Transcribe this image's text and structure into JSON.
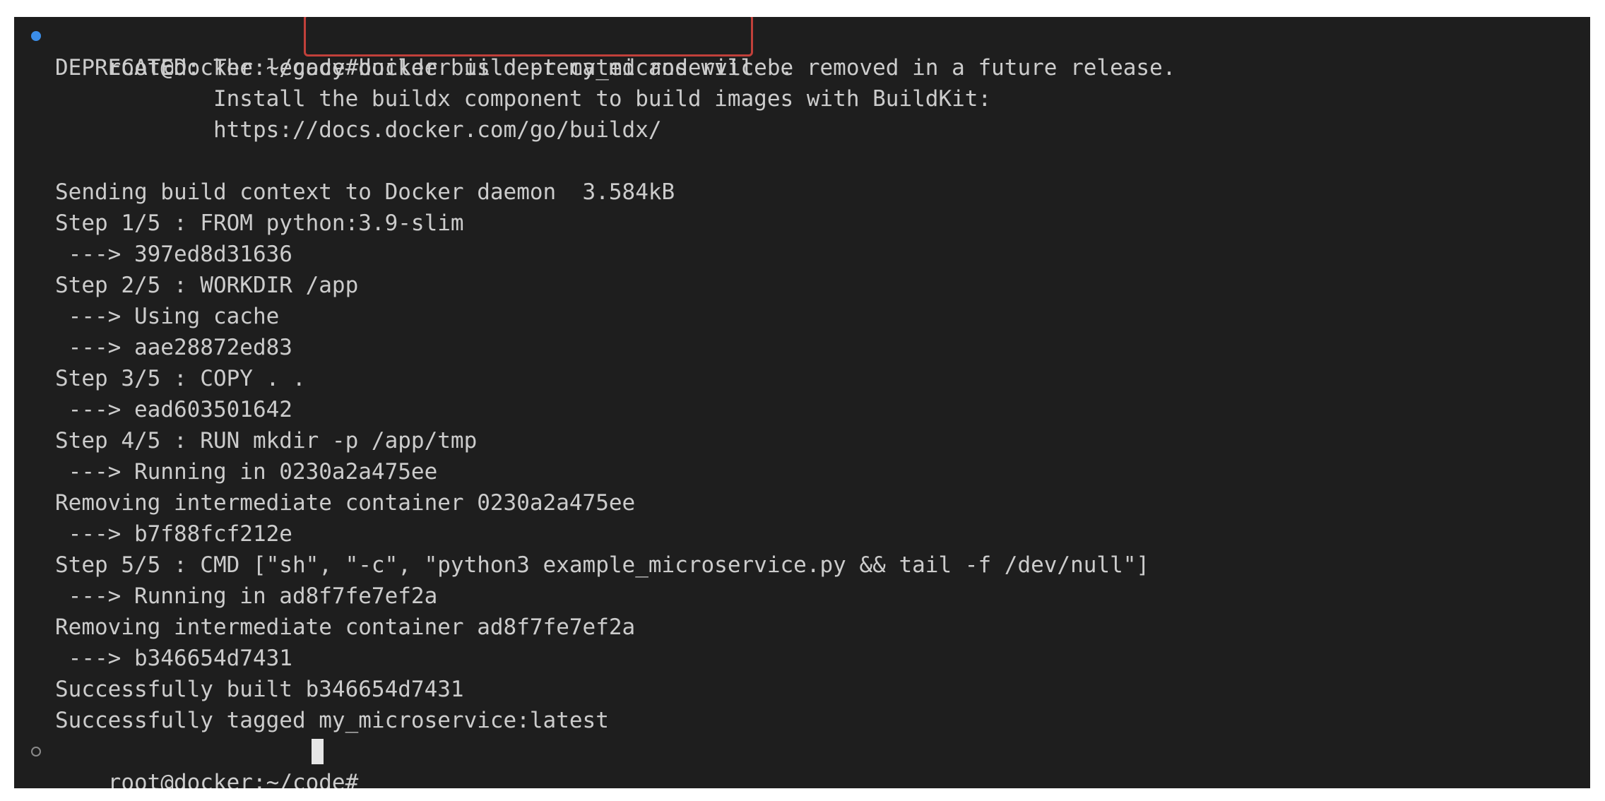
{
  "terminal": {
    "prompt": "root@docker:~/code#",
    "command": "docker build -t my_microservice .",
    "output_lines": [
      "DEPRECATED: The legacy builder is deprecated and will be removed in a future release.",
      "            Install the buildx component to build images with BuildKit:",
      "            https://docs.docker.com/go/buildx/",
      "",
      "Sending build context to Docker daemon  3.584kB",
      "Step 1/5 : FROM python:3.9-slim",
      " ---> 397ed8d31636",
      "Step 2/5 : WORKDIR /app",
      " ---> Using cache",
      " ---> aae28872ed83",
      "Step 3/5 : COPY . .",
      " ---> ead603501642",
      "Step 4/5 : RUN mkdir -p /app/tmp",
      " ---> Running in 0230a2a475ee",
      "Removing intermediate container 0230a2a475ee",
      " ---> b7f88fcf212e",
      "Step 5/5 : CMD [\"sh\", \"-c\", \"python3 example_microservice.py && tail -f /dev/null\"]",
      " ---> Running in ad8f7fe7ef2a",
      "Removing intermediate container ad8f7fe7ef2a",
      " ---> b346654d7431",
      "Successfully built b346654d7431",
      "Successfully tagged my_microservice:latest"
    ],
    "final_prompt": "root@docker:~/code# ",
    "colors": {
      "background": "#1e1e1e",
      "text": "#cccccc",
      "highlight_box": "#c1403a",
      "status_dot": "#3b8eea"
    }
  }
}
